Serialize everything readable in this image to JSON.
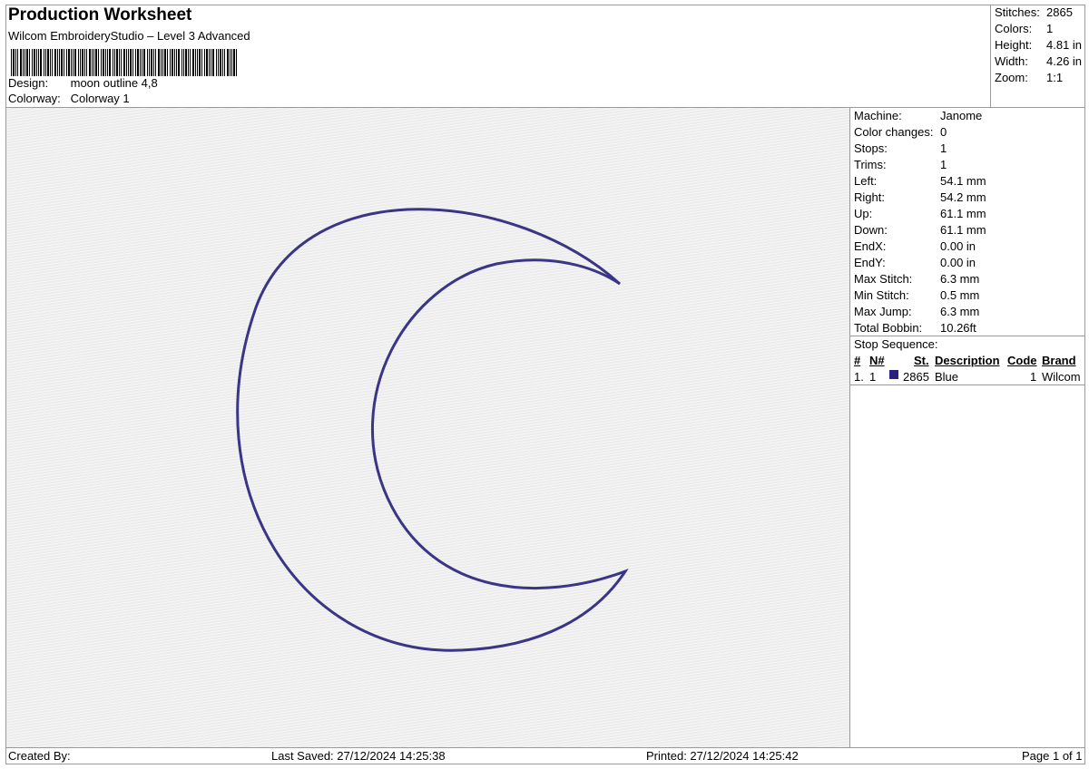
{
  "header": {
    "title": "Production Worksheet",
    "subtitle": "Wilcom EmbroideryStudio – Level 3 Advanced",
    "design_label": "Design:",
    "design_value": "moon outline 4,8",
    "colorway_label": "Colorway:",
    "colorway_value": "Colorway 1"
  },
  "summary": [
    {
      "label": "Stitches:",
      "value": "2865"
    },
    {
      "label": "Colors:",
      "value": "1"
    },
    {
      "label": "Height:",
      "value": "4.81 in"
    },
    {
      "label": "Width:",
      "value": "4.26 in"
    },
    {
      "label": "Zoom:",
      "value": "1:1"
    }
  ],
  "machine_info": [
    {
      "label": "Machine:",
      "value": "Janome"
    },
    {
      "label": "Color changes:",
      "value": "0"
    },
    {
      "label": "Stops:",
      "value": "1"
    },
    {
      "label": "Trims:",
      "value": "1"
    },
    {
      "label": "Left:",
      "value": "54.1 mm"
    },
    {
      "label": "Right:",
      "value": "54.2 mm"
    },
    {
      "label": "Up:",
      "value": "61.1 mm"
    },
    {
      "label": "Down:",
      "value": "61.1 mm"
    },
    {
      "label": "EndX:",
      "value": "0.00 in"
    },
    {
      "label": "EndY:",
      "value": "0.00 in"
    },
    {
      "label": "Max Stitch:",
      "value": "6.3 mm"
    },
    {
      "label": "Min Stitch:",
      "value": "0.5 mm"
    },
    {
      "label": "Max Jump:",
      "value": "6.3 mm"
    },
    {
      "label": "Total Bobbin:",
      "value": "10.26ft"
    }
  ],
  "stop_sequence": {
    "title": "Stop Sequence:",
    "headers": {
      "num": "#",
      "n": "N#",
      "st": "St.",
      "description": "Description",
      "code": "Code",
      "brand": "Brand"
    },
    "rows": [
      {
        "num": "1.",
        "n": "1",
        "color": "#2a2080",
        "st": "2865",
        "description": "Blue",
        "code": "1",
        "brand": "Wilcom"
      }
    ]
  },
  "design_preview": {
    "thread_color": "#3a3585",
    "fabric_color": "#ececec"
  },
  "footer": {
    "created_by": "Created By:",
    "last_saved": "Last Saved: 27/12/2024 14:25:38",
    "printed": "Printed: 27/12/2024 14:25:42",
    "page": "Page 1 of 1"
  }
}
